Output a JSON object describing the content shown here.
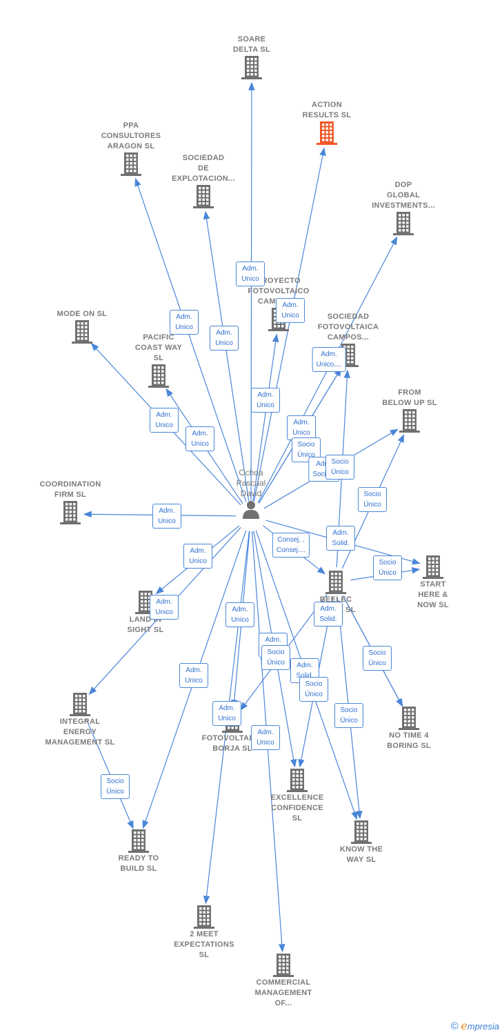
{
  "colors": {
    "link": "#4a86d8",
    "node": "#707070",
    "highlight": "#f05a28",
    "label": "#7a7a7a"
  },
  "person": {
    "id": "p",
    "label": "Ochoa\nPascual\nDavid",
    "icon": "person-icon"
  },
  "nodes": [
    {
      "id": "soare",
      "label": "SOARE\nDELTA SL"
    },
    {
      "id": "action",
      "label": "ACTION\nRESULTS SL",
      "highlight": true
    },
    {
      "id": "ppa",
      "label": "PPA\nCONSULTORES\nARAGON SL"
    },
    {
      "id": "socexp",
      "label": "SOCIEDAD\nDE\nEXPLOTACION..."
    },
    {
      "id": "dop",
      "label": "DOP\nGLOBAL\nINVESTMENTS..."
    },
    {
      "id": "proy",
      "label": "PROYECTO\nFOTOVOLTAICO\nCAMPOS..."
    },
    {
      "id": "socfot",
      "label": "SOCIEDAD\nFOTOVOLTAICA\nCAMPOS..."
    },
    {
      "id": "modeon",
      "label": "MODE ON SL"
    },
    {
      "id": "pacific",
      "label": "PACIFIC\nCOAST WAY\nSL"
    },
    {
      "id": "frombelow",
      "label": "FROM\nBELOW UP SL"
    },
    {
      "id": "coord",
      "label": "COORDINATION\nFIRM SL"
    },
    {
      "id": "start",
      "label": "START\nHERE &\nNOW SL"
    },
    {
      "id": "beelec",
      "label": "BEELEC\nBORJA SL"
    },
    {
      "id": "land",
      "label": "LAND IN\nSIGHT SL"
    },
    {
      "id": "integral",
      "label": "INTEGRAL\nENERGY\nMANAGEMENT SL"
    },
    {
      "id": "notime",
      "label": "NO TIME 4\nBORING SL"
    },
    {
      "id": "fotoborja",
      "label": "FOTOVOLTAICA\nBORJA SL"
    },
    {
      "id": "excel",
      "label": "EXCELLENCE\nCONFIDENCE\nSL"
    },
    {
      "id": "know",
      "label": "KNOW THE\nWAY SL"
    },
    {
      "id": "ready",
      "label": "READY TO\nBUILD SL"
    },
    {
      "id": "meet",
      "label": "2 MEET\nEXPECTATIONS\nSL"
    },
    {
      "id": "commercial",
      "label": "COMMERCIAL\nMANAGEMENT\nOF..."
    }
  ],
  "edges": [
    {
      "from": "p",
      "to": "soare",
      "label": "Adm.\nUnico"
    },
    {
      "from": "p",
      "to": "action",
      "label": "Adm.\nUnico"
    },
    {
      "from": "p",
      "to": "ppa",
      "label": "Adm.\nUnico"
    },
    {
      "from": "p",
      "to": "socexp",
      "label": "Adm.\nUnico"
    },
    {
      "from": "p",
      "to": "proy",
      "label": "Adm.\nUnico"
    },
    {
      "from": "p",
      "to": "socfot",
      "label": "Adm.\nUnico,..."
    },
    {
      "from": "p",
      "to": "socfot",
      "label": "Adm.\nUnico"
    },
    {
      "from": "p",
      "to": "dop",
      "label": "Socio\nÚnico"
    },
    {
      "from": "p",
      "to": "modeon",
      "label": "Adm.\nUnico"
    },
    {
      "from": "p",
      "to": "pacific",
      "label": "Adm.\nUnico"
    },
    {
      "from": "p",
      "to": "frombelow",
      "label": "Adm.\nSocio..."
    },
    {
      "from": "beelec",
      "to": "socfot",
      "label": "Socio\nÚnico"
    },
    {
      "from": "beelec",
      "to": "frombelow",
      "label": "Socio\nÚnico"
    },
    {
      "from": "p",
      "to": "coord",
      "label": "Adm.\nUnico"
    },
    {
      "from": "p",
      "to": "start",
      "label": "Adm.\nSolid."
    },
    {
      "from": "beelec",
      "to": "start",
      "label": "Socio\nÚnico"
    },
    {
      "from": "p",
      "to": "beelec",
      "label": "Consej. ,\nConsej...."
    },
    {
      "from": "p",
      "to": "land",
      "label": "Adm.\nUnico"
    },
    {
      "from": "p",
      "to": "integral",
      "label": "Adm.\nUnico"
    },
    {
      "from": "p",
      "to": "fotoborja",
      "label": "Adm.\nUnico"
    },
    {
      "from": "p",
      "to": "ready",
      "label": "Adm.\nUnico"
    },
    {
      "from": "integral",
      "to": "ready",
      "label": "Socio\nÚnico"
    },
    {
      "from": "p",
      "to": "excel",
      "label": "Adm.\nUnico"
    },
    {
      "from": "beelec",
      "to": "fotoborja",
      "label": "Socio\nÚnico"
    },
    {
      "from": "p",
      "to": "know",
      "label": "Adm.\nSolid."
    },
    {
      "from": "beelec",
      "to": "excel",
      "label": "Socio\nÚnico"
    },
    {
      "from": "beelec",
      "to": "notime",
      "label": "Adm.\nSolid."
    },
    {
      "from": "beelec",
      "to": "notime",
      "label": "Socio\nÚnico"
    },
    {
      "from": "beelec",
      "to": "know",
      "label": "Socio\nÚnico"
    },
    {
      "from": "p",
      "to": "meet",
      "label": "Adm.\nUnico"
    },
    {
      "from": "p",
      "to": "commercial",
      "label": "Adm.\nUnico"
    }
  ],
  "logo": {
    "copyright": "©",
    "brand_initial": "e",
    "brand_rest": "mpresia"
  }
}
